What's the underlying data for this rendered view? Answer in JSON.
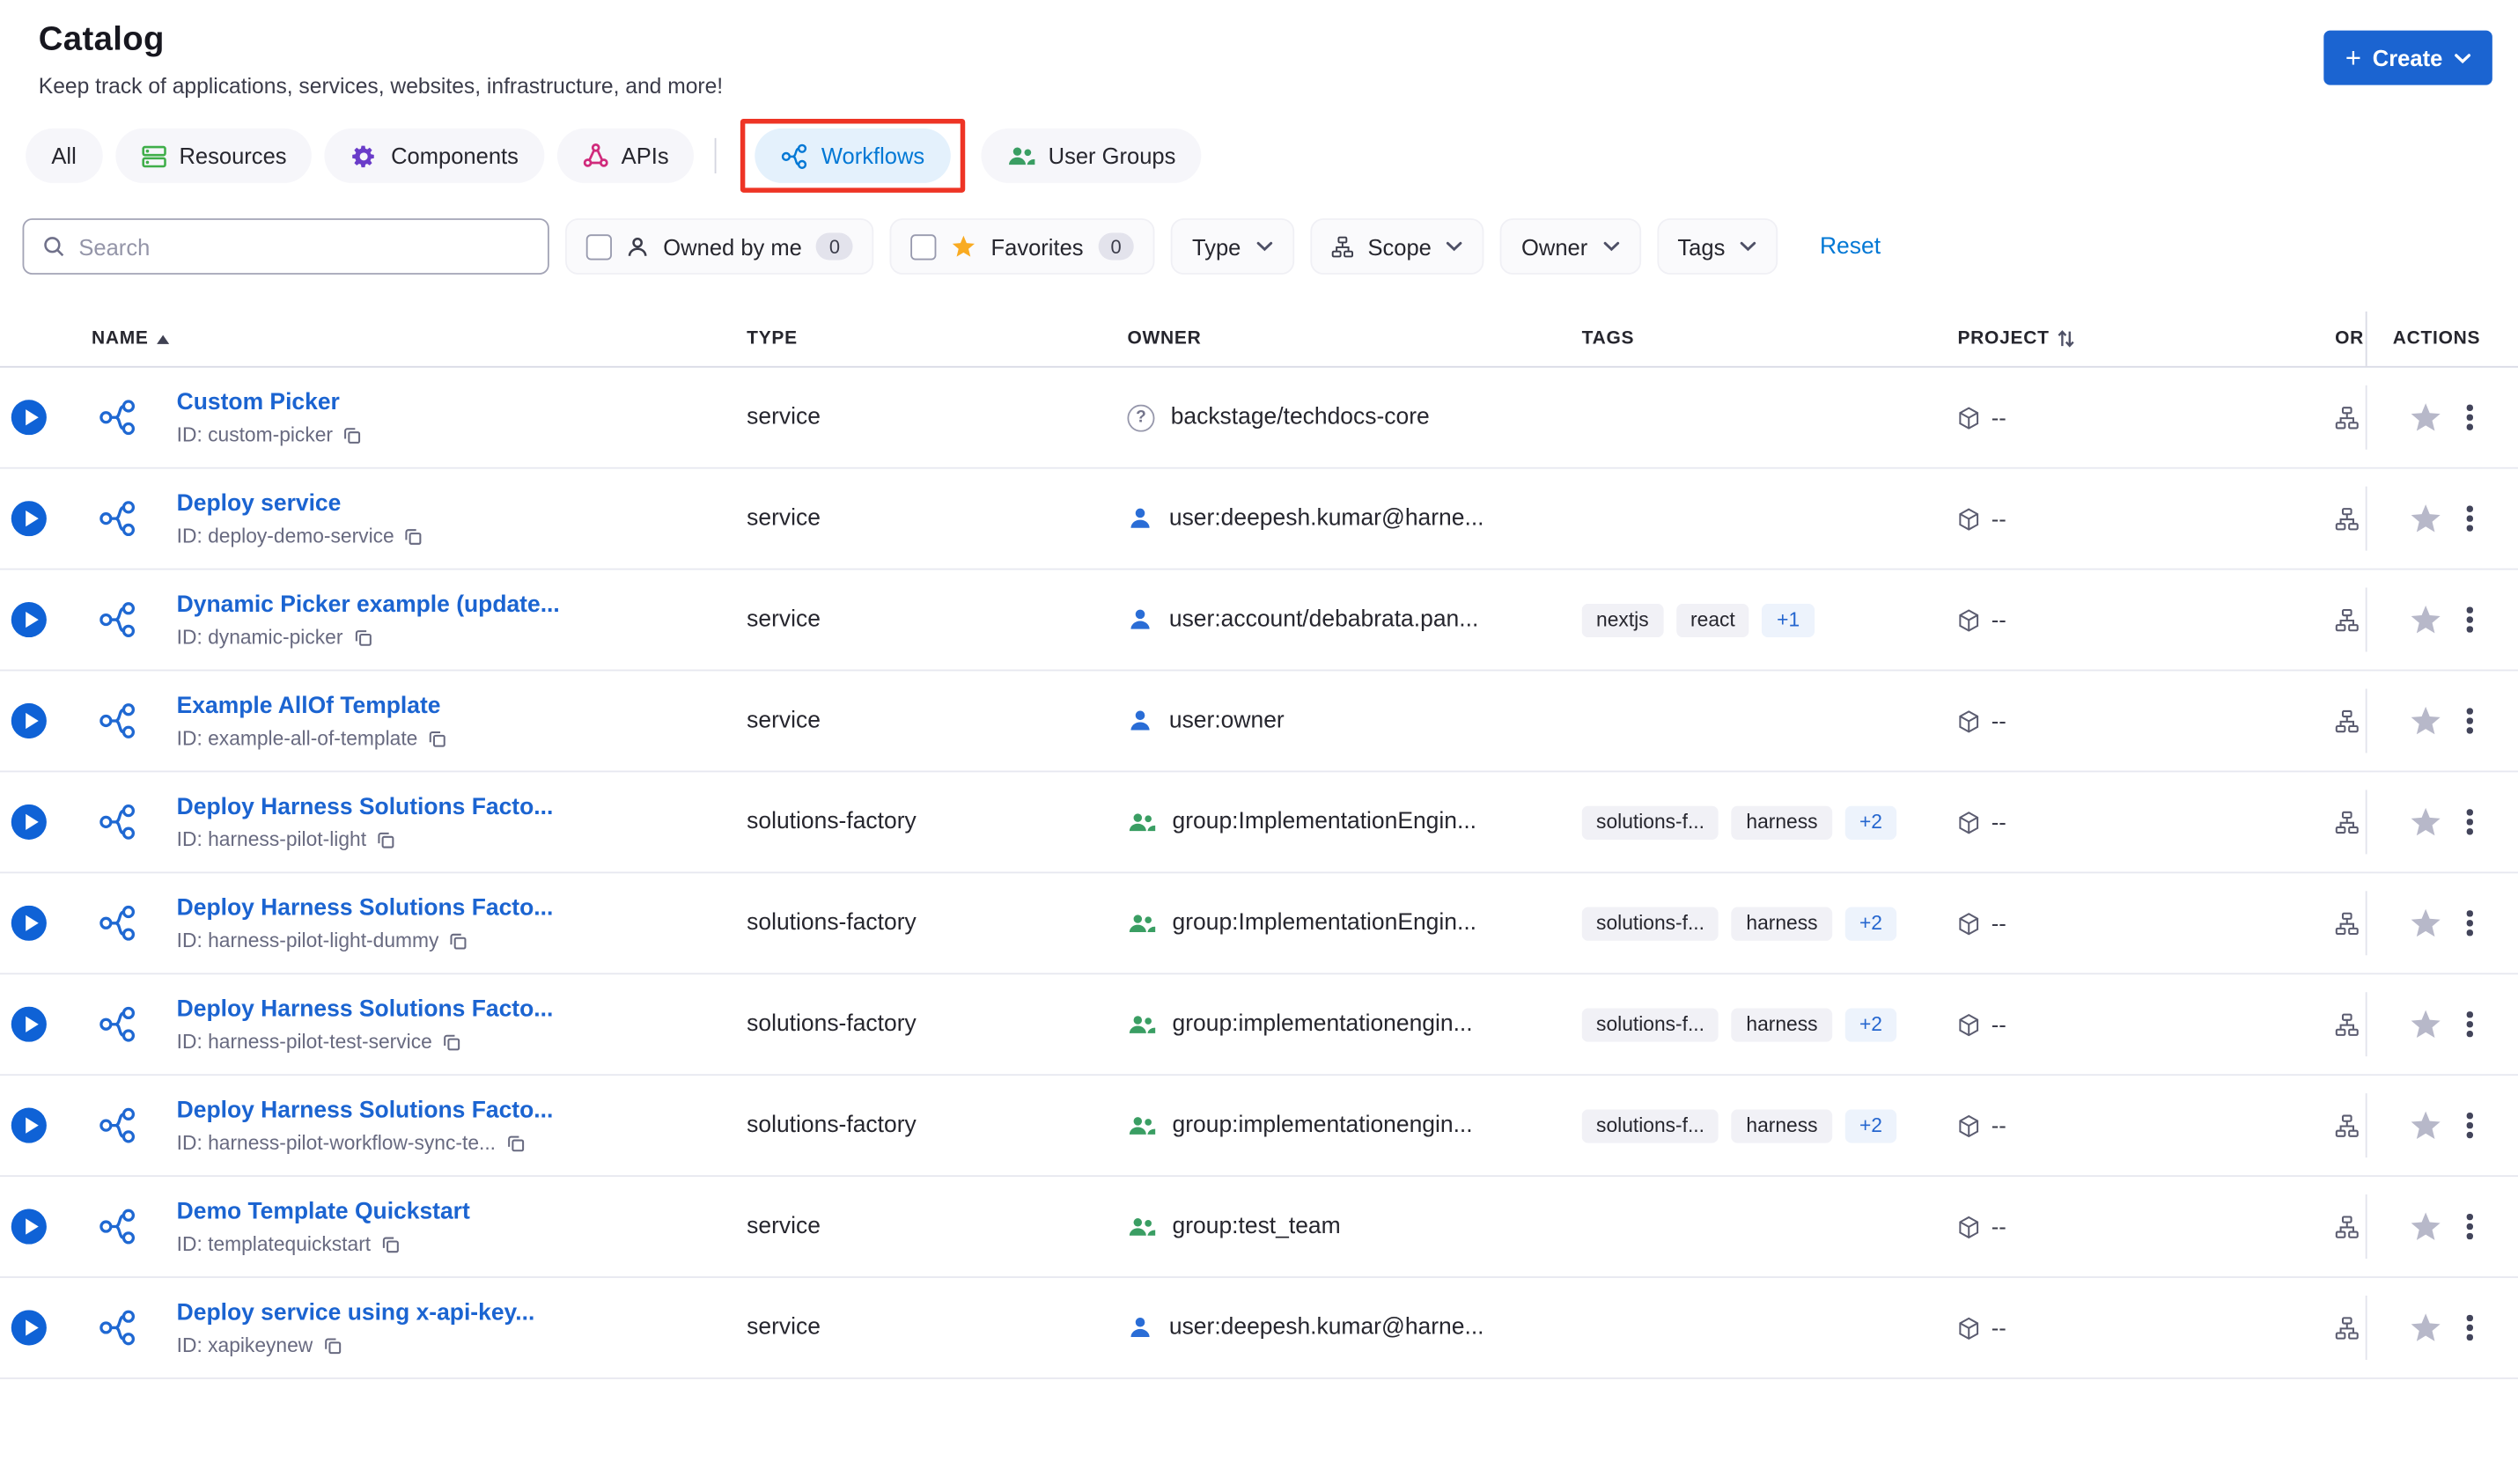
{
  "colors": {
    "primary_button_blue": "#1b64d1",
    "link_blue": "#1b64d1",
    "active_tab_blue": "#0278d5",
    "annotation_red": "#ee3425",
    "favorites_star_yellow": "#f9ab22"
  },
  "header": {
    "title": "Catalog",
    "subtitle": "Keep track of applications, services, websites, infrastructure, and more!",
    "create_label": "Create"
  },
  "tabs": [
    {
      "label": "All",
      "icon": null
    },
    {
      "label": "Resources",
      "icon": "resources-icon"
    },
    {
      "label": "Components",
      "icon": "components-icon"
    },
    {
      "label": "APIs",
      "icon": "apis-icon"
    },
    {
      "label": "Workflows",
      "icon": "workflows-icon",
      "selected": true,
      "annotated": true
    },
    {
      "label": "User Groups",
      "icon": "user-groups-icon"
    }
  ],
  "filters": {
    "search_placeholder": "Search",
    "owned_by_me_label": "Owned by me",
    "owned_by_me_count": "0",
    "favorites_label": "Favorites",
    "favorites_count": "0",
    "type_label": "Type",
    "scope_label": "Scope",
    "owner_label": "Owner",
    "tags_label": "Tags",
    "reset_label": "Reset"
  },
  "table": {
    "headers": {
      "name": "NAME",
      "type": "TYPE",
      "owner": "OWNER",
      "tags": "TAGS",
      "project": "PROJECT",
      "org": "OR",
      "actions": "ACTIONS"
    },
    "rows": [
      {
        "name": "Custom Picker",
        "id": "ID: custom-picker",
        "type": "service",
        "owner": {
          "icon": "question",
          "text": "backstage/techdocs-core"
        },
        "tags": [],
        "project": "--"
      },
      {
        "name": "Deploy service",
        "id": "ID: deploy-demo-service",
        "type": "service",
        "owner": {
          "icon": "user",
          "text": "user:deepesh.kumar@harne..."
        },
        "tags": [],
        "project": "--"
      },
      {
        "name": "Dynamic Picker example (update...",
        "id": "ID: dynamic-picker",
        "type": "service",
        "owner": {
          "icon": "user",
          "text": "user:account/debabrata.pan..."
        },
        "tags": [
          {
            "label": "nextjs",
            "variant": "default"
          },
          {
            "label": "react",
            "variant": "default"
          },
          {
            "label": "+1",
            "variant": "count"
          }
        ],
        "project": "--"
      },
      {
        "name": "Example AllOf Template",
        "id": "ID: example-all-of-template",
        "type": "service",
        "owner": {
          "icon": "user",
          "text": "user:owner"
        },
        "tags": [],
        "project": "--"
      },
      {
        "name": "Deploy Harness Solutions Facto...",
        "id": "ID: harness-pilot-light",
        "type": "solutions-factory",
        "owner": {
          "icon": "group",
          "text": "group:ImplementationEngin..."
        },
        "tags": [
          {
            "label": "solutions-f...",
            "variant": "default"
          },
          {
            "label": "harness",
            "variant": "default"
          },
          {
            "label": "+2",
            "variant": "count"
          }
        ],
        "project": "--"
      },
      {
        "name": "Deploy Harness Solutions Facto...",
        "id": "ID: harness-pilot-light-dummy",
        "type": "solutions-factory",
        "owner": {
          "icon": "group",
          "text": "group:ImplementationEngin..."
        },
        "tags": [
          {
            "label": "solutions-f...",
            "variant": "default"
          },
          {
            "label": "harness",
            "variant": "default"
          },
          {
            "label": "+2",
            "variant": "count"
          }
        ],
        "project": "--"
      },
      {
        "name": "Deploy Harness Solutions Facto...",
        "id": "ID: harness-pilot-test-service",
        "type": "solutions-factory",
        "owner": {
          "icon": "group",
          "text": "group:implementationengin..."
        },
        "tags": [
          {
            "label": "solutions-f...",
            "variant": "default"
          },
          {
            "label": "harness",
            "variant": "default"
          },
          {
            "label": "+2",
            "variant": "count"
          }
        ],
        "project": "--"
      },
      {
        "name": "Deploy Harness Solutions Facto...",
        "id": "ID: harness-pilot-workflow-sync-te...",
        "type": "solutions-factory",
        "owner": {
          "icon": "group",
          "text": "group:implementationengin..."
        },
        "tags": [
          {
            "label": "solutions-f...",
            "variant": "default"
          },
          {
            "label": "harness",
            "variant": "default"
          },
          {
            "label": "+2",
            "variant": "count"
          }
        ],
        "project": "--"
      },
      {
        "name": "Demo Template Quickstart",
        "id": "ID: templatequickstart",
        "type": "service",
        "owner": {
          "icon": "group",
          "text": "group:test_team"
        },
        "tags": [],
        "project": "--"
      },
      {
        "name": "Deploy service using x-api-key...",
        "id": "ID: xapikeynew",
        "type": "service",
        "owner": {
          "icon": "user",
          "text": "user:deepesh.kumar@harne..."
        },
        "tags": [],
        "project": "--"
      }
    ]
  }
}
